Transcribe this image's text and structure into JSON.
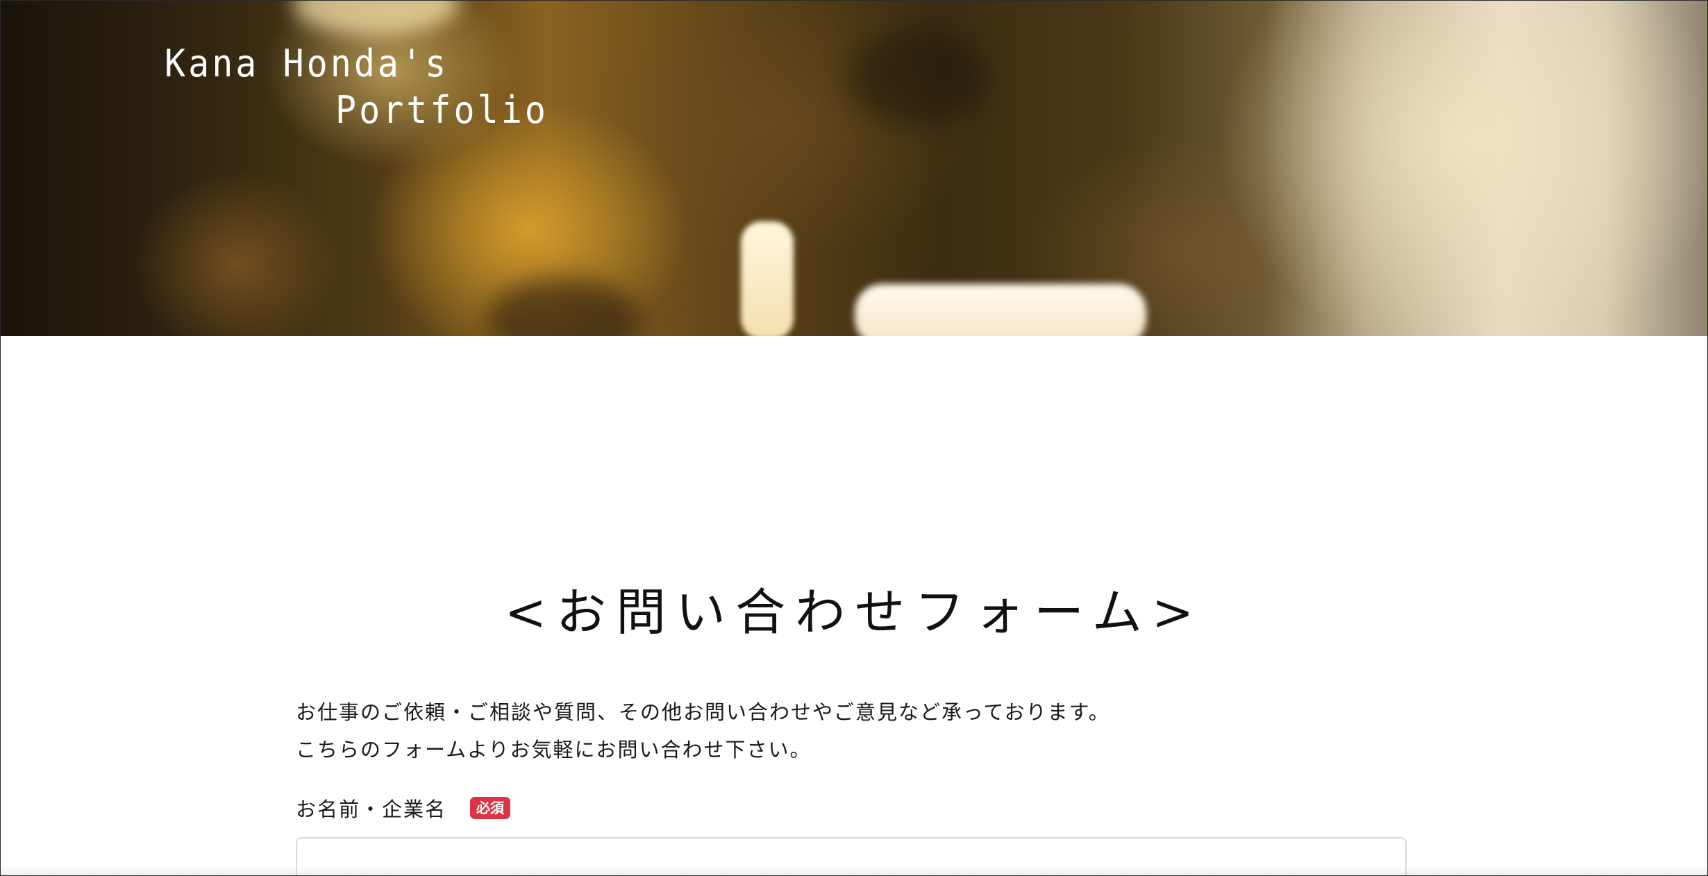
{
  "header": {
    "logo_line1": "Kana Honda's",
    "logo_line2": "Portfolio"
  },
  "contact": {
    "title": "<お問い合わせフォーム>",
    "intro_lines": [
      "お仕事のご依頼・ご相談や質問、その他お問い合わせやご意見など承っております。",
      "こちらのフォームよりお気軽にお問い合わせ下さい。"
    ],
    "fields": [
      {
        "label": "お名前・企業名",
        "required_badge": "必須",
        "value": ""
      }
    ]
  },
  "colors": {
    "required_badge": "#dc3545",
    "input_border": "#d7dadd"
  }
}
